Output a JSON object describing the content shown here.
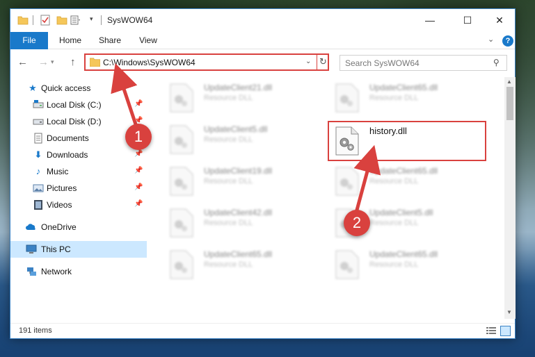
{
  "window": {
    "title": "SysWOW64",
    "controls": {
      "minimize": "—",
      "maximize": "☐",
      "close": "✕"
    }
  },
  "ribbon": {
    "tabs": [
      {
        "label": "File",
        "active": true
      },
      {
        "label": "Home"
      },
      {
        "label": "Share"
      },
      {
        "label": "View"
      }
    ],
    "help": "?"
  },
  "address": {
    "path": "C:\\Windows\\SysWOW64",
    "search_placeholder": "Search SysWOW64"
  },
  "nav_pane": {
    "items": [
      {
        "label": "Quick access",
        "icon": "star-icon",
        "pinned": false
      },
      {
        "label": "Local Disk (C:)",
        "icon": "drive-icon",
        "pinned": true
      },
      {
        "label": "Local Disk (D:)",
        "icon": "drive-icon",
        "pinned": true
      },
      {
        "label": "Documents",
        "icon": "documents-icon",
        "pinned": true
      },
      {
        "label": "Downloads",
        "icon": "download-icon",
        "pinned": true
      },
      {
        "label": "Music",
        "icon": "music-icon",
        "pinned": true
      },
      {
        "label": "Pictures",
        "icon": "pictures-icon",
        "pinned": true
      },
      {
        "label": "Videos",
        "icon": "videos-icon",
        "pinned": true
      },
      {
        "label": "OneDrive",
        "icon": "cloud-icon"
      },
      {
        "label": "This PC",
        "icon": "computer-icon",
        "selected": true
      },
      {
        "label": "Network",
        "icon": "network-icon"
      }
    ]
  },
  "files": {
    "left_column": [
      {
        "name": "UpdateClient21.dll",
        "type": "Resource DLL"
      },
      {
        "name": "UpdateClient5.dll",
        "type": "Resource DLL"
      },
      {
        "name": "UpdateClient19.dll",
        "type": "Resource DLL"
      },
      {
        "name": "UpdateClient42.dll",
        "type": "Resource DLL"
      },
      {
        "name": "UpdateClient65.dll",
        "type": "Resource DLL"
      }
    ],
    "right_column": [
      {
        "name": "UpdateClient65.dll",
        "type": "Resource DLL"
      },
      {
        "name": "history.dll",
        "type": ""
      },
      {
        "name": "UpdateClient65.dll",
        "type": "Resource DLL"
      },
      {
        "name": "UpdateClient5.dll",
        "type": "Resource DLL"
      },
      {
        "name": "UpdateClient65.dll",
        "type": "Resource DLL"
      }
    ]
  },
  "status": {
    "item_count": "191 items"
  },
  "annotations": {
    "step1": "1",
    "step2": "2",
    "color": "#d9413e"
  }
}
